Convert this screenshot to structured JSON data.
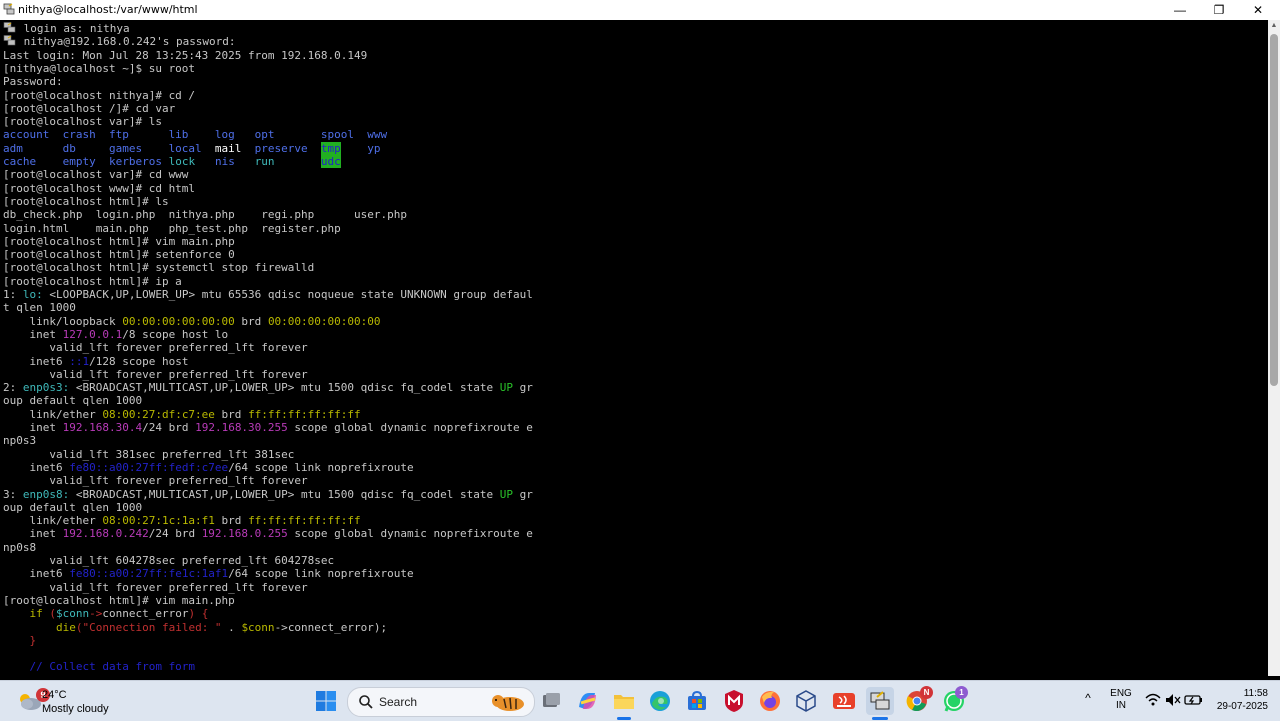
{
  "window": {
    "title": "nithya@localhost:/var/www/html",
    "minimize_glyph": "—",
    "maximize_glyph": "❐",
    "close_glyph": "✕"
  },
  "colors": {
    "terminal_bg": "#000000",
    "text": "#c7c7c7",
    "blue": "#4f6fe8",
    "white": "#ffffff",
    "cyan": "#3fb9ba",
    "green": "#29c229",
    "yellow": "#b8b800",
    "magenta": "#b93bb9",
    "red": "#c03030",
    "darkblue": "#2222c8",
    "tmp_bg": "#21b021"
  },
  "terminal": {
    "lines": [
      [
        {
          "t": "login as: nithya",
          "c": "text"
        }
      ],
      [
        {
          "t": "nithya@192.168.0.242's password:",
          "c": "text"
        }
      ],
      [
        {
          "t": "Last login: Mon Jul 28 13:25:43 2025 from 192.168.0.149",
          "c": "text"
        }
      ],
      [
        {
          "t": "[nithya@localhost ~]$ su root",
          "c": "text"
        }
      ],
      [
        {
          "t": "Password:",
          "c": "text"
        }
      ],
      [
        {
          "t": "[root@localhost nithya]# cd /",
          "c": "text"
        }
      ],
      [
        {
          "t": "[root@localhost /]# cd var",
          "c": "text"
        }
      ],
      [
        {
          "t": "[root@localhost var]# ls",
          "c": "text"
        }
      ],
      [
        {
          "t": "account  crash  ftp      lib    log   opt       spool  www",
          "c": "blue"
        }
      ],
      [
        {
          "t": "adm      db     games    local  ",
          "c": "blue"
        },
        {
          "t": "mail",
          "c": "white"
        },
        {
          "t": "  preserve  ",
          "c": "blue"
        },
        {
          "t": "tmp",
          "c": "tmp"
        },
        {
          "t": "    yp",
          "c": "blue"
        }
      ],
      [
        {
          "t": "cache    empty  kerberos ",
          "c": "blue"
        },
        {
          "t": "lock",
          "c": "cyan"
        },
        {
          "t": "   nis   ",
          "c": "blue"
        },
        {
          "t": "run",
          "c": "cyan"
        },
        {
          "t": "       ",
          "c": "text"
        },
        {
          "t": "udc",
          "c": "tmp"
        }
      ],
      [
        {
          "t": "[root@localhost var]# cd www",
          "c": "text"
        }
      ],
      [
        {
          "t": "[root@localhost www]# cd html",
          "c": "text"
        }
      ],
      [
        {
          "t": "[root@localhost html]# ls",
          "c": "text"
        }
      ],
      [
        {
          "t": "db_check.php  login.php  nithya.php    regi.php      user.php",
          "c": "text"
        }
      ],
      [
        {
          "t": "login.html    main.php   php_test.php  register.php",
          "c": "text"
        }
      ],
      [
        {
          "t": "[root@localhost html]# vim main.php",
          "c": "text"
        }
      ],
      [
        {
          "t": "[root@localhost html]# setenforce 0",
          "c": "text"
        }
      ],
      [
        {
          "t": "[root@localhost html]# systemctl stop firewalld",
          "c": "text"
        }
      ],
      [
        {
          "t": "[root@localhost html]# ip a",
          "c": "text"
        }
      ],
      [
        {
          "t": "1: ",
          "c": "text"
        },
        {
          "t": "lo:",
          "c": "cyan"
        },
        {
          "t": " <LOOPBACK,UP,LOWER_UP> mtu 65536 qdisc noqueue state UNKNOWN group defaul",
          "c": "text"
        }
      ],
      [
        {
          "t": "t qlen 1000",
          "c": "text"
        }
      ],
      [
        {
          "t": "    link/loopback ",
          "c": "text"
        },
        {
          "t": "00:00:00:00:00:00",
          "c": "yellow"
        },
        {
          "t": " brd ",
          "c": "text"
        },
        {
          "t": "00:00:00:00:00:00",
          "c": "yellow"
        }
      ],
      [
        {
          "t": "    inet ",
          "c": "text"
        },
        {
          "t": "127.0.0.1",
          "c": "magenta"
        },
        {
          "t": "/8 scope host lo",
          "c": "text"
        }
      ],
      [
        {
          "t": "       valid_lft forever preferred_lft forever",
          "c": "text"
        }
      ],
      [
        {
          "t": "    inet6 ",
          "c": "text"
        },
        {
          "t": "::1",
          "c": "darkblue"
        },
        {
          "t": "/128 scope host",
          "c": "text"
        }
      ],
      [
        {
          "t": "       valid_lft forever preferred_lft forever",
          "c": "text"
        }
      ],
      [
        {
          "t": "2: ",
          "c": "text"
        },
        {
          "t": "enp0s3:",
          "c": "cyan"
        },
        {
          "t": " <BROADCAST,MULTICAST,UP,LOWER_UP> mtu 1500 qdisc fq_codel state ",
          "c": "text"
        },
        {
          "t": "UP",
          "c": "green"
        },
        {
          "t": " gr",
          "c": "text"
        }
      ],
      [
        {
          "t": "oup default qlen 1000",
          "c": "text"
        }
      ],
      [
        {
          "t": "    link/ether ",
          "c": "text"
        },
        {
          "t": "08:00:27:df:c7:ee",
          "c": "yellow"
        },
        {
          "t": " brd ",
          "c": "text"
        },
        {
          "t": "ff:ff:ff:ff:ff:ff",
          "c": "yellow"
        }
      ],
      [
        {
          "t": "    inet ",
          "c": "text"
        },
        {
          "t": "192.168.30.4",
          "c": "magenta"
        },
        {
          "t": "/24 brd ",
          "c": "text"
        },
        {
          "t": "192.168.30.255",
          "c": "magenta"
        },
        {
          "t": " scope global dynamic noprefixroute e",
          "c": "text"
        }
      ],
      [
        {
          "t": "np0s3",
          "c": "text"
        }
      ],
      [
        {
          "t": "       valid_lft 381sec preferred_lft 381sec",
          "c": "text"
        }
      ],
      [
        {
          "t": "    inet6 ",
          "c": "text"
        },
        {
          "t": "fe80::a00:27ff:fedf:c7ee",
          "c": "darkblue"
        },
        {
          "t": "/64 scope link noprefixroute",
          "c": "text"
        }
      ],
      [
        {
          "t": "       valid_lft forever preferred_lft forever",
          "c": "text"
        }
      ],
      [
        {
          "t": "3: ",
          "c": "text"
        },
        {
          "t": "enp0s8:",
          "c": "cyan"
        },
        {
          "t": " <BROADCAST,MULTICAST,UP,LOWER_UP> mtu 1500 qdisc fq_codel state ",
          "c": "text"
        },
        {
          "t": "UP",
          "c": "green"
        },
        {
          "t": " gr",
          "c": "text"
        }
      ],
      [
        {
          "t": "oup default qlen 1000",
          "c": "text"
        }
      ],
      [
        {
          "t": "    link/ether ",
          "c": "text"
        },
        {
          "t": "08:00:27:1c:1a:f1",
          "c": "yellow"
        },
        {
          "t": " brd ",
          "c": "text"
        },
        {
          "t": "ff:ff:ff:ff:ff:ff",
          "c": "yellow"
        }
      ],
      [
        {
          "t": "    inet ",
          "c": "text"
        },
        {
          "t": "192.168.0.242",
          "c": "magenta"
        },
        {
          "t": "/24 brd ",
          "c": "text"
        },
        {
          "t": "192.168.0.255",
          "c": "magenta"
        },
        {
          "t": " scope global dynamic noprefixroute e",
          "c": "text"
        }
      ],
      [
        {
          "t": "np0s8",
          "c": "text"
        }
      ],
      [
        {
          "t": "       valid_lft 604278sec preferred_lft 604278sec",
          "c": "text"
        }
      ],
      [
        {
          "t": "    inet6 ",
          "c": "text"
        },
        {
          "t": "fe80::a00:27ff:fe1c:1af1",
          "c": "darkblue"
        },
        {
          "t": "/64 scope link noprefixroute",
          "c": "text"
        }
      ],
      [
        {
          "t": "       valid_lft forever preferred_lft forever",
          "c": "text"
        }
      ],
      [
        {
          "t": "[root@localhost html]# vim main.php",
          "c": "text"
        }
      ],
      [
        {
          "t": "    ",
          "c": "text"
        },
        {
          "t": "if",
          "c": "yellow"
        },
        {
          "t": " (",
          "c": "red"
        },
        {
          "t": "$conn",
          "c": "cyan"
        },
        {
          "t": "->",
          "c": "red"
        },
        {
          "t": "connect_error",
          "c": "text"
        },
        {
          "t": ") {",
          "c": "red"
        }
      ],
      [
        {
          "t": "        ",
          "c": "text"
        },
        {
          "t": "die",
          "c": "yellow"
        },
        {
          "t": "(",
          "c": "red"
        },
        {
          "t": "\"Connection failed: \"",
          "c": "red"
        },
        {
          "t": " . ",
          "c": "text"
        },
        {
          "t": "$conn",
          "c": "yellow"
        },
        {
          "t": "->",
          "c": "text"
        },
        {
          "t": "connect_error",
          "c": "text"
        },
        {
          "t": ");",
          "c": "text"
        }
      ],
      [
        {
          "t": "    }",
          "c": "red"
        }
      ],
      [
        {
          "t": "",
          "c": "text"
        }
      ],
      [
        {
          "t": "    // Collect data from form",
          "c": "darkblue"
        }
      ]
    ]
  },
  "taskbar": {
    "weather": {
      "badge": "9",
      "temp": "24°C",
      "desc": "Mostly cloudy"
    },
    "search_label": "Search",
    "apps": [
      {
        "name": "start-icon"
      },
      {
        "name": "task-view-icon"
      },
      {
        "name": "copilot-icon"
      },
      {
        "name": "file-explorer-icon"
      },
      {
        "name": "edge-icon"
      },
      {
        "name": "microsoft-store-icon"
      },
      {
        "name": "mcafee-icon"
      },
      {
        "name": "firefox-icon"
      },
      {
        "name": "virtualbox-icon"
      },
      {
        "name": "java-icon"
      },
      {
        "name": "putty-icon"
      },
      {
        "name": "chrome-icon",
        "badge": "N"
      },
      {
        "name": "whatsapp-icon",
        "badge": "1"
      }
    ],
    "tray": {
      "chevron": "^",
      "lang_line1": "ENG",
      "lang_line2": "IN",
      "time": "11:58",
      "date": "29-07-2025"
    }
  }
}
